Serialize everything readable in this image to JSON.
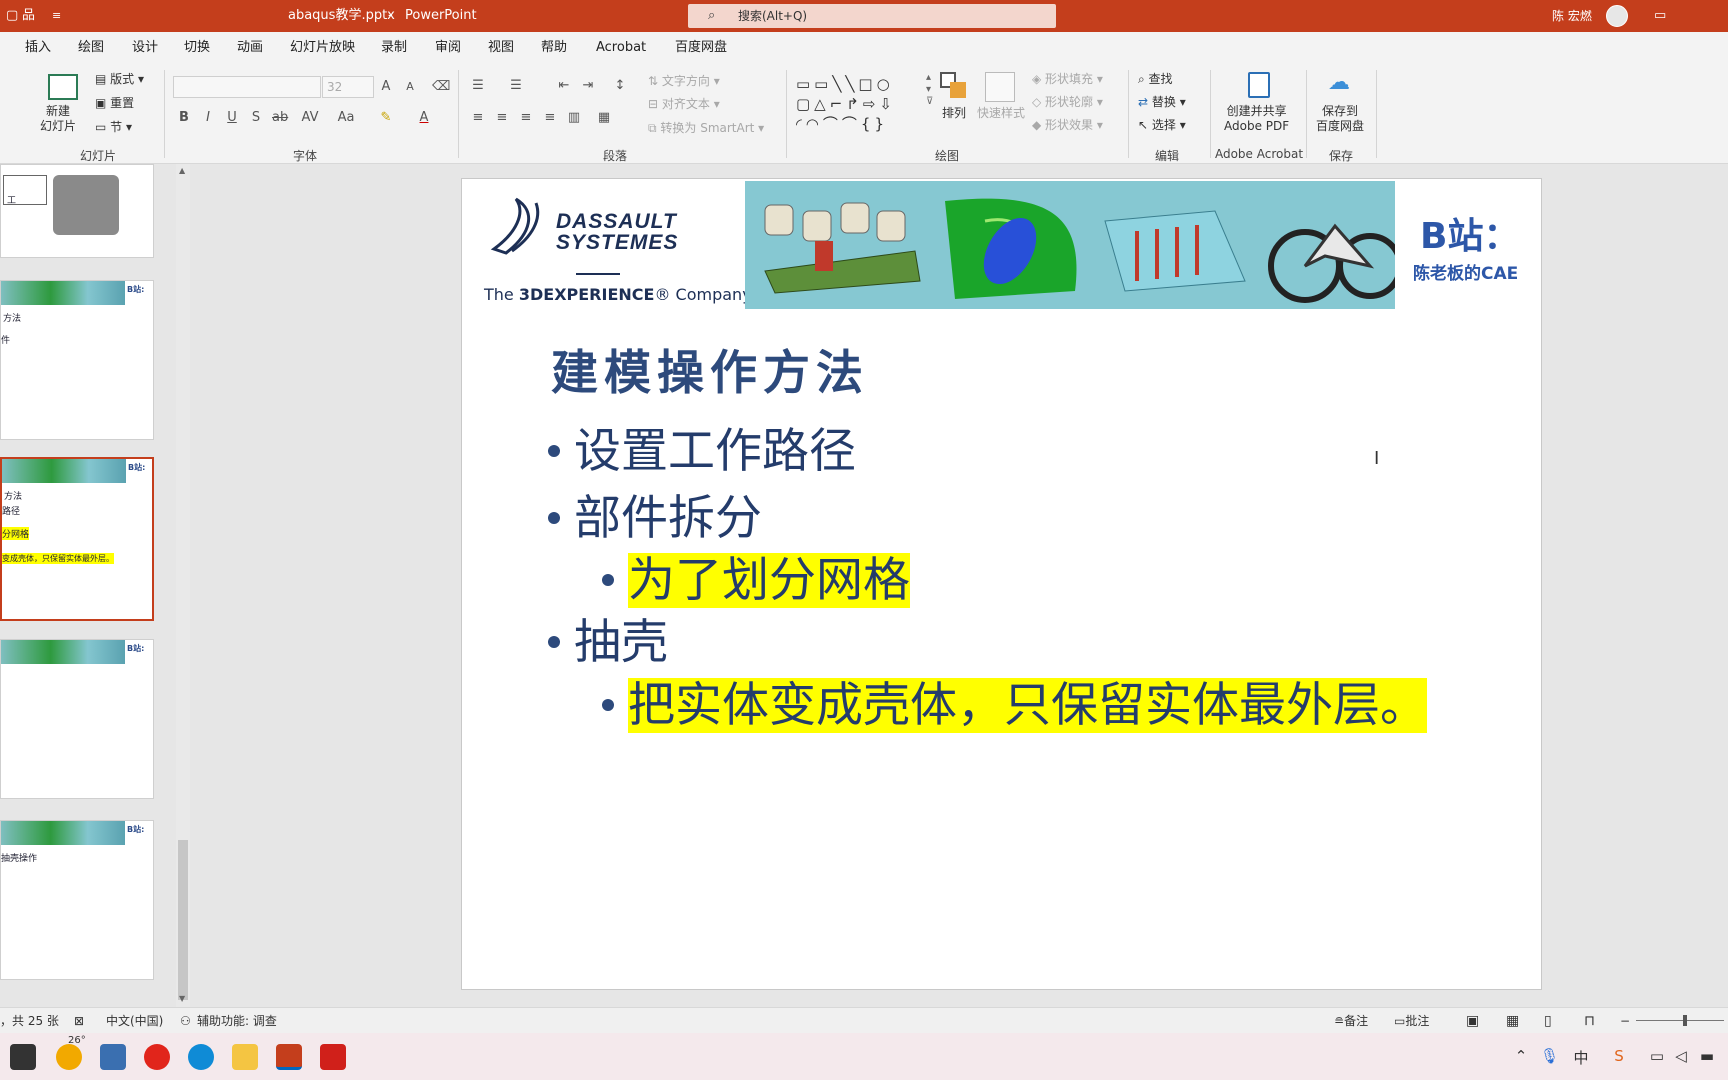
{
  "titlebar": {
    "filename": "abaqus教学.pptx",
    "separator": "-",
    "app": "PowerPoint",
    "search_placeholder": "搜索(Alt+Q)",
    "user": "陈 宏燃"
  },
  "menu": [
    "插入",
    "绘图",
    "设计",
    "切换",
    "动画",
    "幻灯片放映",
    "录制",
    "审阅",
    "视图",
    "帮助",
    "Acrobat",
    "百度网盘"
  ],
  "ribbon": {
    "slides": {
      "new_slide": "新建\n幻灯片",
      "layout": "版式",
      "reset": "重置",
      "section": "节",
      "group": "幻灯片"
    },
    "font": {
      "size": "32",
      "group": "字体"
    },
    "paragraph": {
      "text_direction": "文字方向",
      "align_text": "对齐文本",
      "convert_smartart": "转换为 SmartArt",
      "group": "段落"
    },
    "drawing": {
      "arrange": "排列",
      "quick_styles": "快速样式",
      "shape_fill": "形状填充",
      "shape_outline": "形状轮廓",
      "shape_effects": "形状效果",
      "group": "绘图"
    },
    "editing": {
      "find": "查找",
      "replace": "替换",
      "select": "选择",
      "group": "编辑"
    },
    "acrobat": {
      "create_share": "创建并共享\nAdobe PDF",
      "group": "Adobe Acrobat"
    },
    "save": {
      "save_baidu": "保存到\n百度网盘",
      "group": "保存"
    }
  },
  "thumbnails": [
    {
      "lines": [
        "工"
      ]
    },
    {
      "badge": "B站:",
      "lines": [
        "方法",
        "件"
      ]
    },
    {
      "badge": "B站:",
      "lines": [
        "方法",
        "路径",
        "分网格",
        "变成壳体，只保留实体最外层。"
      ],
      "selected": true
    },
    {
      "badge": "B站:",
      "lines": []
    },
    {
      "badge": "B站:",
      "lines": [
        "抽壳操作"
      ]
    }
  ],
  "slide": {
    "logo_brand": "DASSAULT\nSYSTEMES",
    "logo_tagline_pre": "The ",
    "logo_tagline_bold": "3DEXPERIENCE",
    "logo_tagline_post": "® Company",
    "bilibili_label": "B站：",
    "bilibili_sub": "陈老板的CAE",
    "title": "建模操作方法",
    "bullets": [
      {
        "level": 1,
        "text": "设置工作路径"
      },
      {
        "level": 1,
        "text": "部件拆分"
      },
      {
        "level": 2,
        "text": "为了划分网格",
        "highlight": true
      },
      {
        "level": 1,
        "text": "抽壳"
      },
      {
        "level": 2,
        "text": "把实体变成壳体，只保留实体最外层。",
        "highlight": true
      }
    ]
  },
  "statusbar": {
    "slide_count": "，共 25 张",
    "language": "中文(中国)",
    "accessibility": "辅助功能: 调查",
    "notes": "备注",
    "comments": "批注"
  },
  "taskbar": {
    "weather_temp": "26°"
  },
  "colors": {
    "titlebar": "#c43e1c",
    "title_text": "#2d4a7c",
    "highlight": "#ffff00"
  }
}
